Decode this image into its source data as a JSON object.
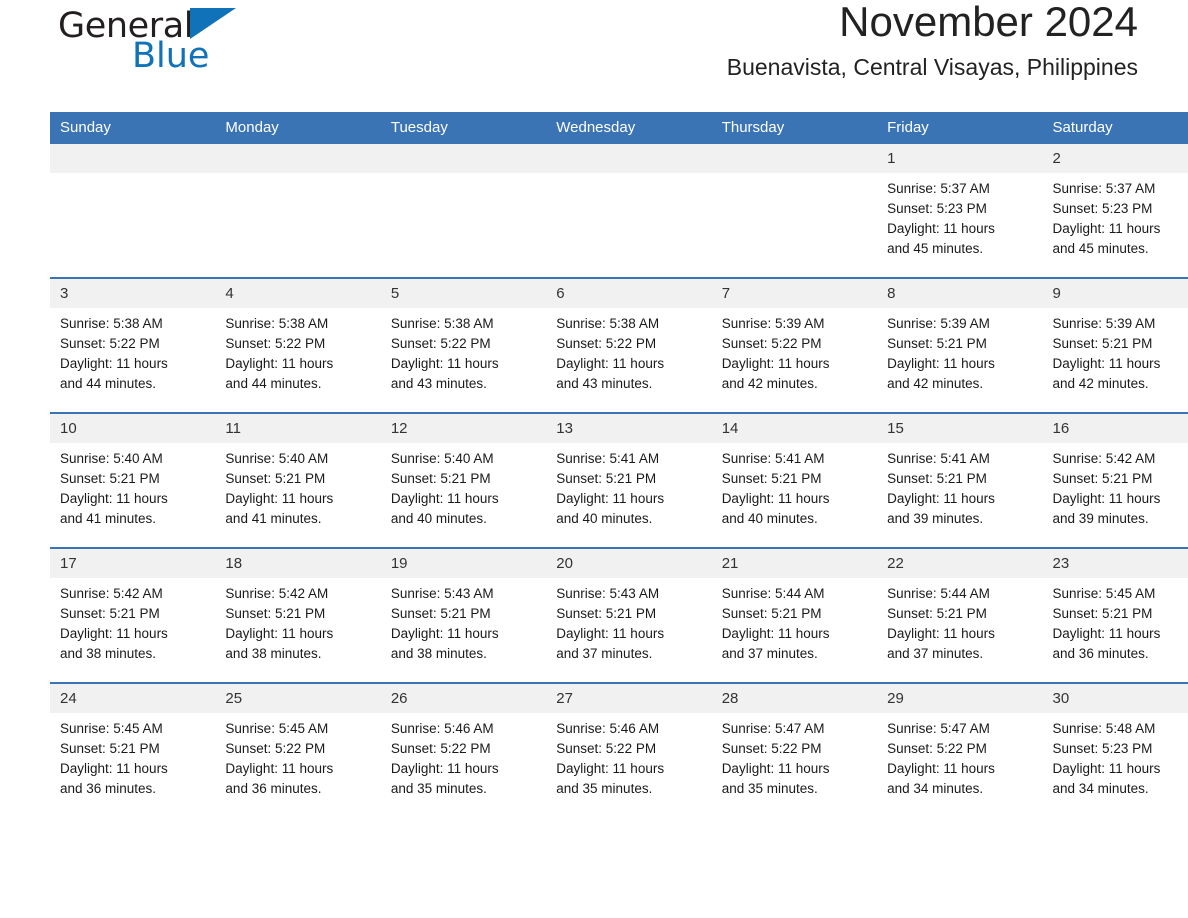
{
  "brand": {
    "name_part1": "General",
    "name_part2": "Blue",
    "logo_icon": "triangle-logo-icon",
    "accent_color": "#1073b9"
  },
  "header": {
    "month_title": "November 2024",
    "location": "Buenavista, Central Visayas, Philippines"
  },
  "theme": {
    "header_blue": "#3b74b4",
    "row_divider_blue": "#3b74b4",
    "daynum_bg": "#f1f1f1"
  },
  "weekday_headers": [
    "Sunday",
    "Monday",
    "Tuesday",
    "Wednesday",
    "Thursday",
    "Friday",
    "Saturday"
  ],
  "weeks": [
    [
      {
        "day": "",
        "blank": true
      },
      {
        "day": "",
        "blank": true
      },
      {
        "day": "",
        "blank": true
      },
      {
        "day": "",
        "blank": true
      },
      {
        "day": "",
        "blank": true
      },
      {
        "day": "1",
        "sunrise": "Sunrise: 5:37 AM",
        "sunset": "Sunset: 5:23 PM",
        "daylight_l1": "Daylight: 11 hours",
        "daylight_l2": "and 45 minutes."
      },
      {
        "day": "2",
        "sunrise": "Sunrise: 5:37 AM",
        "sunset": "Sunset: 5:23 PM",
        "daylight_l1": "Daylight: 11 hours",
        "daylight_l2": "and 45 minutes."
      }
    ],
    [
      {
        "day": "3",
        "sunrise": "Sunrise: 5:38 AM",
        "sunset": "Sunset: 5:22 PM",
        "daylight_l1": "Daylight: 11 hours",
        "daylight_l2": "and 44 minutes."
      },
      {
        "day": "4",
        "sunrise": "Sunrise: 5:38 AM",
        "sunset": "Sunset: 5:22 PM",
        "daylight_l1": "Daylight: 11 hours",
        "daylight_l2": "and 44 minutes."
      },
      {
        "day": "5",
        "sunrise": "Sunrise: 5:38 AM",
        "sunset": "Sunset: 5:22 PM",
        "daylight_l1": "Daylight: 11 hours",
        "daylight_l2": "and 43 minutes."
      },
      {
        "day": "6",
        "sunrise": "Sunrise: 5:38 AM",
        "sunset": "Sunset: 5:22 PM",
        "daylight_l1": "Daylight: 11 hours",
        "daylight_l2": "and 43 minutes."
      },
      {
        "day": "7",
        "sunrise": "Sunrise: 5:39 AM",
        "sunset": "Sunset: 5:22 PM",
        "daylight_l1": "Daylight: 11 hours",
        "daylight_l2": "and 42 minutes."
      },
      {
        "day": "8",
        "sunrise": "Sunrise: 5:39 AM",
        "sunset": "Sunset: 5:21 PM",
        "daylight_l1": "Daylight: 11 hours",
        "daylight_l2": "and 42 minutes."
      },
      {
        "day": "9",
        "sunrise": "Sunrise: 5:39 AM",
        "sunset": "Sunset: 5:21 PM",
        "daylight_l1": "Daylight: 11 hours",
        "daylight_l2": "and 42 minutes."
      }
    ],
    [
      {
        "day": "10",
        "sunrise": "Sunrise: 5:40 AM",
        "sunset": "Sunset: 5:21 PM",
        "daylight_l1": "Daylight: 11 hours",
        "daylight_l2": "and 41 minutes."
      },
      {
        "day": "11",
        "sunrise": "Sunrise: 5:40 AM",
        "sunset": "Sunset: 5:21 PM",
        "daylight_l1": "Daylight: 11 hours",
        "daylight_l2": "and 41 minutes."
      },
      {
        "day": "12",
        "sunrise": "Sunrise: 5:40 AM",
        "sunset": "Sunset: 5:21 PM",
        "daylight_l1": "Daylight: 11 hours",
        "daylight_l2": "and 40 minutes."
      },
      {
        "day": "13",
        "sunrise": "Sunrise: 5:41 AM",
        "sunset": "Sunset: 5:21 PM",
        "daylight_l1": "Daylight: 11 hours",
        "daylight_l2": "and 40 minutes."
      },
      {
        "day": "14",
        "sunrise": "Sunrise: 5:41 AM",
        "sunset": "Sunset: 5:21 PM",
        "daylight_l1": "Daylight: 11 hours",
        "daylight_l2": "and 40 minutes."
      },
      {
        "day": "15",
        "sunrise": "Sunrise: 5:41 AM",
        "sunset": "Sunset: 5:21 PM",
        "daylight_l1": "Daylight: 11 hours",
        "daylight_l2": "and 39 minutes."
      },
      {
        "day": "16",
        "sunrise": "Sunrise: 5:42 AM",
        "sunset": "Sunset: 5:21 PM",
        "daylight_l1": "Daylight: 11 hours",
        "daylight_l2": "and 39 minutes."
      }
    ],
    [
      {
        "day": "17",
        "sunrise": "Sunrise: 5:42 AM",
        "sunset": "Sunset: 5:21 PM",
        "daylight_l1": "Daylight: 11 hours",
        "daylight_l2": "and 38 minutes."
      },
      {
        "day": "18",
        "sunrise": "Sunrise: 5:42 AM",
        "sunset": "Sunset: 5:21 PM",
        "daylight_l1": "Daylight: 11 hours",
        "daylight_l2": "and 38 minutes."
      },
      {
        "day": "19",
        "sunrise": "Sunrise: 5:43 AM",
        "sunset": "Sunset: 5:21 PM",
        "daylight_l1": "Daylight: 11 hours",
        "daylight_l2": "and 38 minutes."
      },
      {
        "day": "20",
        "sunrise": "Sunrise: 5:43 AM",
        "sunset": "Sunset: 5:21 PM",
        "daylight_l1": "Daylight: 11 hours",
        "daylight_l2": "and 37 minutes."
      },
      {
        "day": "21",
        "sunrise": "Sunrise: 5:44 AM",
        "sunset": "Sunset: 5:21 PM",
        "daylight_l1": "Daylight: 11 hours",
        "daylight_l2": "and 37 minutes."
      },
      {
        "day": "22",
        "sunrise": "Sunrise: 5:44 AM",
        "sunset": "Sunset: 5:21 PM",
        "daylight_l1": "Daylight: 11 hours",
        "daylight_l2": "and 37 minutes."
      },
      {
        "day": "23",
        "sunrise": "Sunrise: 5:45 AM",
        "sunset": "Sunset: 5:21 PM",
        "daylight_l1": "Daylight: 11 hours",
        "daylight_l2": "and 36 minutes."
      }
    ],
    [
      {
        "day": "24",
        "sunrise": "Sunrise: 5:45 AM",
        "sunset": "Sunset: 5:21 PM",
        "daylight_l1": "Daylight: 11 hours",
        "daylight_l2": "and 36 minutes."
      },
      {
        "day": "25",
        "sunrise": "Sunrise: 5:45 AM",
        "sunset": "Sunset: 5:22 PM",
        "daylight_l1": "Daylight: 11 hours",
        "daylight_l2": "and 36 minutes."
      },
      {
        "day": "26",
        "sunrise": "Sunrise: 5:46 AM",
        "sunset": "Sunset: 5:22 PM",
        "daylight_l1": "Daylight: 11 hours",
        "daylight_l2": "and 35 minutes."
      },
      {
        "day": "27",
        "sunrise": "Sunrise: 5:46 AM",
        "sunset": "Sunset: 5:22 PM",
        "daylight_l1": "Daylight: 11 hours",
        "daylight_l2": "and 35 minutes."
      },
      {
        "day": "28",
        "sunrise": "Sunrise: 5:47 AM",
        "sunset": "Sunset: 5:22 PM",
        "daylight_l1": "Daylight: 11 hours",
        "daylight_l2": "and 35 minutes."
      },
      {
        "day": "29",
        "sunrise": "Sunrise: 5:47 AM",
        "sunset": "Sunset: 5:22 PM",
        "daylight_l1": "Daylight: 11 hours",
        "daylight_l2": "and 34 minutes."
      },
      {
        "day": "30",
        "sunrise": "Sunrise: 5:48 AM",
        "sunset": "Sunset: 5:23 PM",
        "daylight_l1": "Daylight: 11 hours",
        "daylight_l2": "and 34 minutes."
      }
    ]
  ]
}
